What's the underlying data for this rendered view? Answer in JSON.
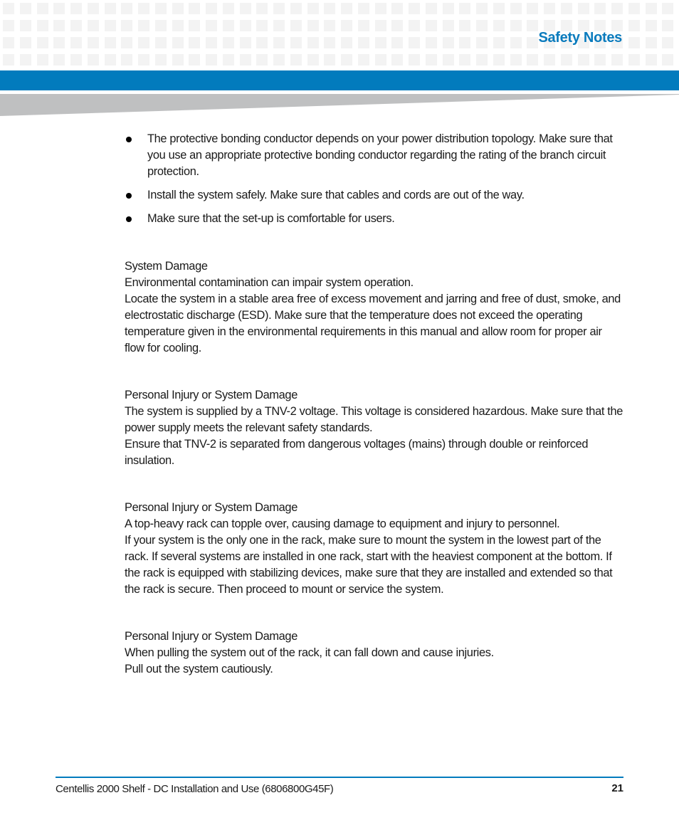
{
  "header": {
    "section_title": "Safety Notes",
    "colors": {
      "accent_blue": "#027bbd",
      "title_blue": "#0a7bbd",
      "grid_gray": "#f3f3f3",
      "wedge_gray": "#bfc0c1"
    }
  },
  "bullets": [
    "The protective bonding conductor depends on your power distribution topology. Make sure that you use an appropriate protective bonding conductor regarding the rating of the branch circuit protection.",
    "Install the system safely. Make sure that cables and cords are out of the way.",
    "Make sure that the set-up is comfortable for users."
  ],
  "notes": [
    {
      "heading": "System Damage",
      "lines": [
        "Environmental contamination can impair system operation.",
        "Locate the system in a stable area free of excess movement and jarring and free of dust, smoke, and electrostatic discharge (ESD). Make sure that the temperature does not exceed the operating temperature given in the environmental requirements in this manual and allow room for proper air flow for cooling."
      ]
    },
    {
      "heading": "Personal Injury or System Damage",
      "lines": [
        "The system is supplied by a TNV-2 voltage. This voltage is considered hazardous. Make sure that the power supply meets the relevant safety standards.",
        "Ensure that TNV-2 is separated from dangerous voltages (mains) through double or reinforced insulation."
      ]
    },
    {
      "heading": "Personal Injury or System Damage",
      "lines": [
        "A top-heavy rack can topple over, causing damage to equipment and injury to personnel.",
        "If your system is the only one in the rack, make sure to mount the system in the lowest part of the rack. If several systems are installed in one rack, start with the heaviest component at the bottom. If the rack is equipped with stabilizing devices, make sure that they are installed and extended so that the rack is secure. Then proceed to mount or service the system."
      ]
    },
    {
      "heading": "Personal Injury or System Damage",
      "lines": [
        "When pulling the system out of the rack, it can fall down and cause injuries.",
        "Pull out the system cautiously."
      ]
    }
  ],
  "footer": {
    "document_title": "Centellis 2000 Shelf - DC Installation and Use (6806800G45F)",
    "page_number": "21"
  }
}
